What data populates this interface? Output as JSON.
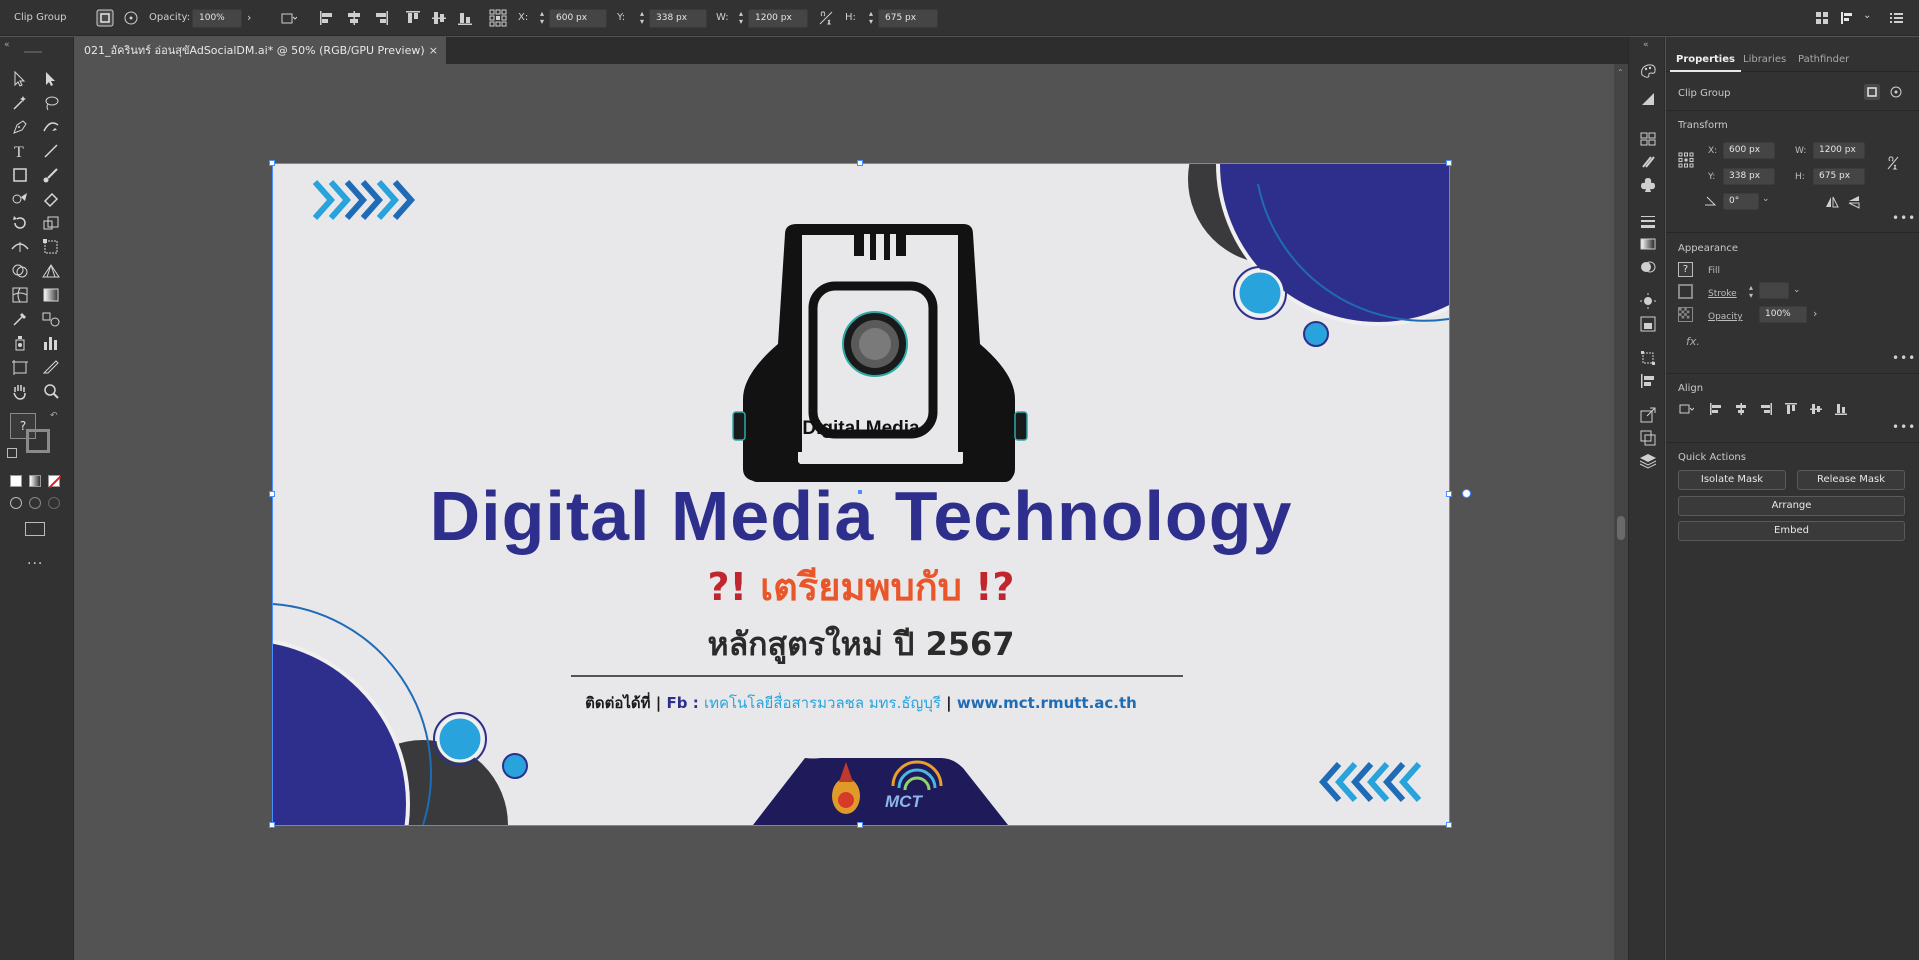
{
  "control_bar": {
    "selection_type": "Clip Group",
    "opacity_label": "Opacity:",
    "opacity_value": "100%",
    "x_label": "X:",
    "x_value": "600 px",
    "y_label": "Y:",
    "y_value": "338 px",
    "w_label": "W:",
    "w_value": "1200 px",
    "h_label": "H:",
    "h_value": "675 px"
  },
  "document_tab": {
    "title": "021_อัครินทร์ อ่อนสุขัAdSocialDM.ai* @ 50% (RGB/GPU Preview)",
    "close": "×"
  },
  "artwork": {
    "logo_text": "Digital Media",
    "title": "Digital Media Technology",
    "tagline": "เตรียมพบกับ",
    "tagline_left": "?!",
    "tagline_right": "!?",
    "subtitle": "หลักสูตรใหม่ ปี 2567",
    "contact_label": "ติดต่อได้ที่ |",
    "fb_label": "Fb :",
    "fb_name": "เทคโนโลยีสื่อสารมวลชล มทร.ธัญบุรี",
    "separator": "|",
    "website": "www.mct.rmutt.ac.th",
    "badge_text": "MCT",
    "colors": {
      "navy": "#2e2f8c",
      "sky": "#29a3dc",
      "orange": "#e8562a",
      "dark": "#2b2b2b",
      "artboard_bg": "#e8e8ea"
    }
  },
  "panel": {
    "tabs": [
      "Properties",
      "Libraries",
      "Pathfinder"
    ],
    "active_tab": "Properties",
    "selection_type": "Clip Group",
    "transform": {
      "title": "Transform",
      "x_label": "X:",
      "x_value": "600 px",
      "y_label": "Y:",
      "y_value": "338 px",
      "w_label": "W:",
      "w_value": "1200 px",
      "h_label": "H:",
      "h_value": "675 px",
      "angle_value": "0°"
    },
    "appearance": {
      "title": "Appearance",
      "fill_label": "Fill",
      "stroke_label": "Stroke",
      "opacity_label": "Opacity",
      "opacity_value": "100%",
      "fx_label": "fx."
    },
    "align": {
      "title": "Align"
    },
    "quick_actions": {
      "title": "Quick Actions",
      "isolate_mask": "Isolate Mask",
      "release_mask": "Release Mask",
      "arrange": "Arrange",
      "embed": "Embed"
    }
  },
  "toolbar": {
    "fill_unknown": "?",
    "more": "..."
  }
}
